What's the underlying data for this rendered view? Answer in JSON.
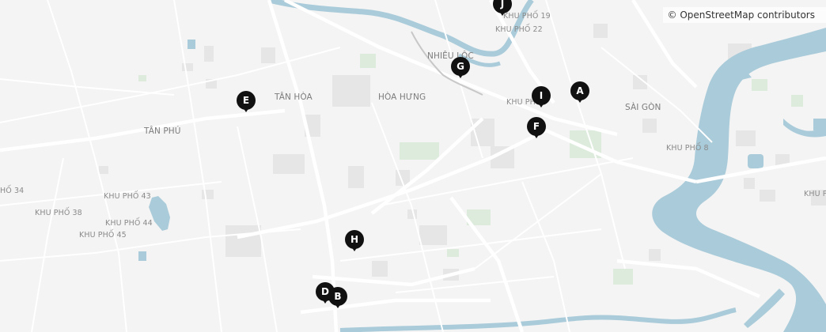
{
  "attribution": "© OpenStreetMap contributors",
  "colors": {
    "land": "#f4f4f4",
    "river": "#aacbd9",
    "park": "#dcebdc",
    "building": "#e4e4e4",
    "road": "#ffffff",
    "marker": "#111111"
  },
  "labels": {
    "khu_pho_19": "KHU PHỐ 19",
    "khu_pho_22": "KHU PHỐ 22",
    "nhieu_loc": "NHIÊU LỘC",
    "tan_hoa": "TÂN HÒA",
    "hoa_hung": "HÒA HƯNG",
    "khu_pho_center": "KHU PH",
    "sai_gon": "SÀI GÒN",
    "tan_phu": "TÂN PHÚ",
    "khu_pho_8": "KHU PHỐ 8",
    "khu_pho_34": "HỐ 34",
    "khu_pho_43": "KHU PHỐ 43",
    "khu_pho_38": "KHU PHỐ 38",
    "khu_pho_44": "KHU PHỐ 44",
    "khu_pho_45": "KHU PHỐ 45",
    "khu_pho_right": "KHU PH"
  },
  "markers": {
    "a": "A",
    "b": "B",
    "d": "D",
    "e": "E",
    "f": "F",
    "g": "G",
    "h": "H",
    "i": "I",
    "j": "J"
  }
}
